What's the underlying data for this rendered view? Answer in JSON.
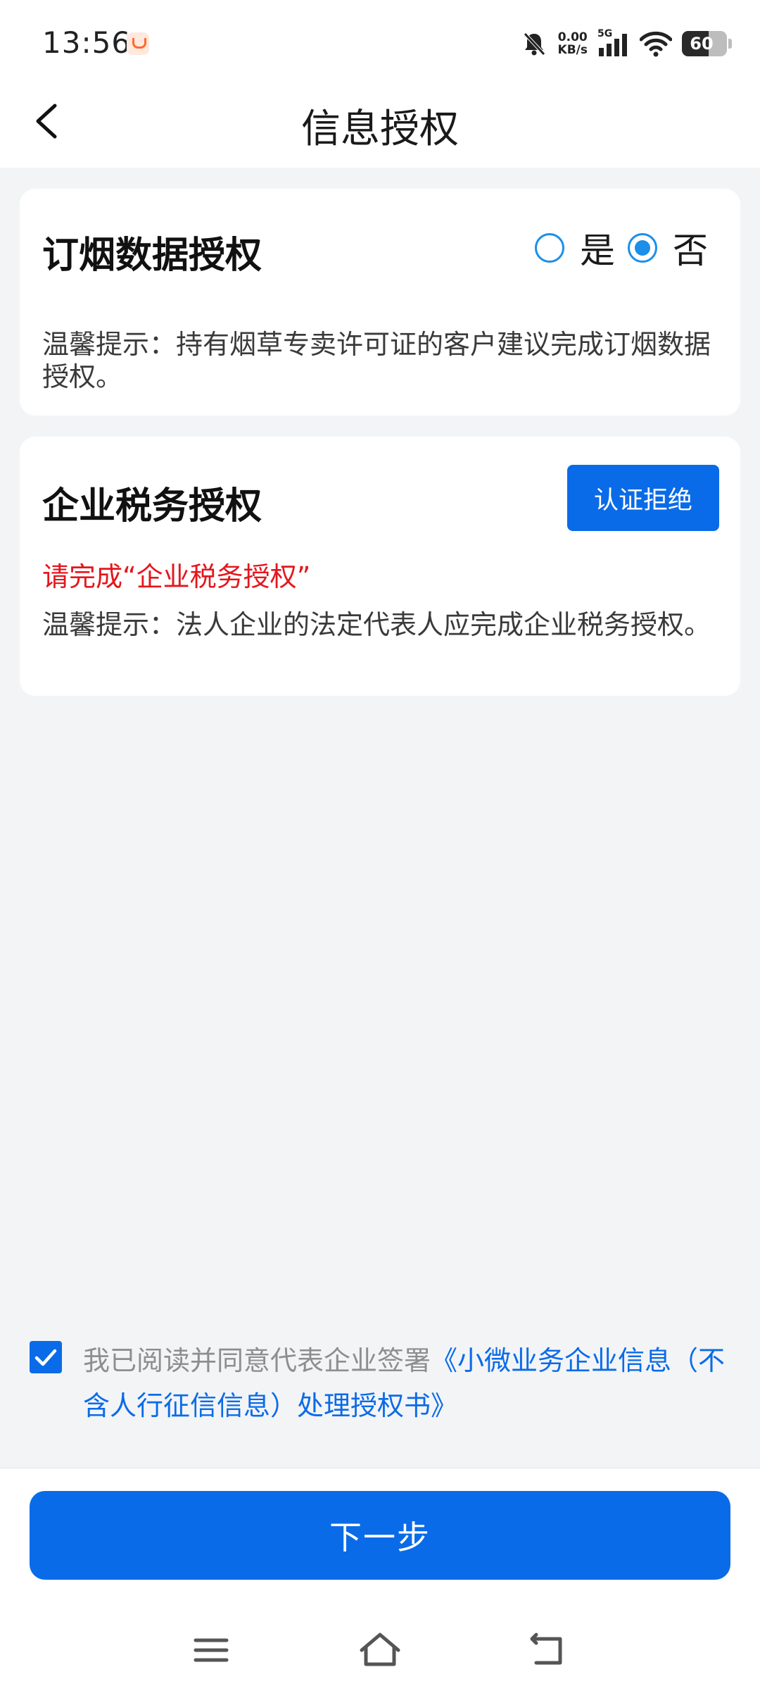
{
  "status_bar": {
    "time": "13:56",
    "net_speed_value": "0.00",
    "net_speed_unit": "KB/s",
    "network_type": "5G",
    "battery": "60",
    "battery_level": 0.6
  },
  "header": {
    "title": "信息授权"
  },
  "tobacco_card": {
    "title": "订烟数据授权",
    "options": [
      {
        "label": "是",
        "checked": false
      },
      {
        "label": "否",
        "checked": true
      }
    ],
    "hint": "温馨提示：持有烟草专卖许可证的客户建议完成订烟数据授权。"
  },
  "tax_card": {
    "title": "企业税务授权",
    "button_label": "认证拒绝",
    "warning": "请完成“企业税务授权”",
    "hint": "温馨提示：法人企业的法定代表人应完成企业税务授权。"
  },
  "agreement": {
    "checked": true,
    "text": "我已阅读并同意代表企业签署",
    "link_text": "《小微业务企业信息（不含人行征信信息）处理授权书》"
  },
  "footer": {
    "next_label": "下一步"
  },
  "colors": {
    "primary": "#0A6BE8",
    "radio": "#1B8FEA",
    "warning": "#E4161D",
    "background": "#F3F4F6"
  }
}
